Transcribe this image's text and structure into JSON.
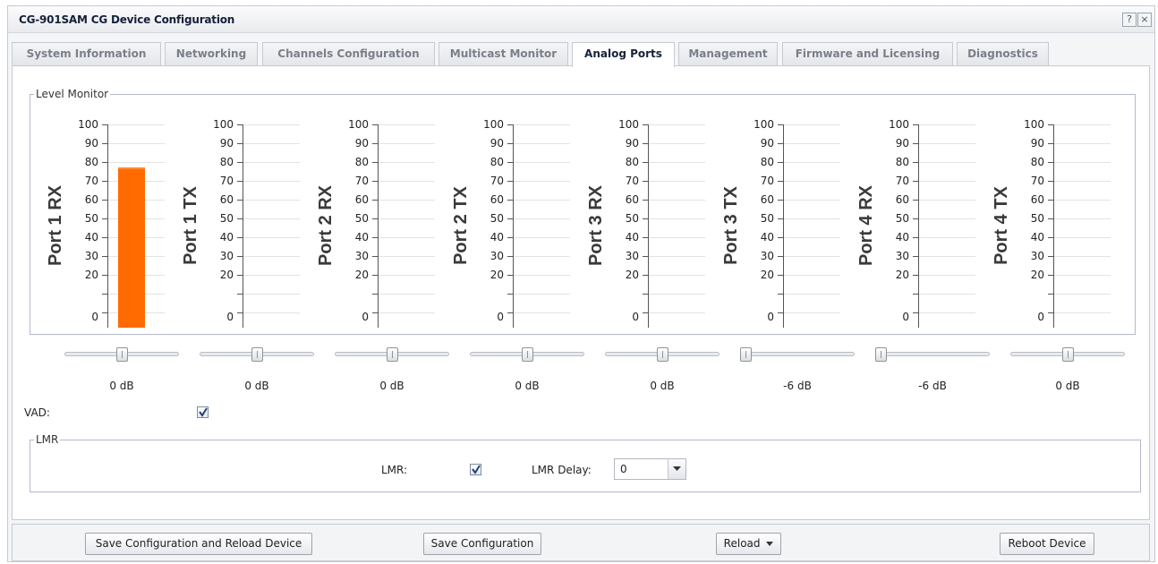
{
  "window": {
    "title": "CG-901SAM CG Device Configuration",
    "help_label": "?",
    "close_label": "×"
  },
  "tabs": [
    {
      "label": "System Information",
      "active": false
    },
    {
      "label": "Networking",
      "active": false
    },
    {
      "label": "Channels Configuration",
      "active": false
    },
    {
      "label": "Multicast Monitor",
      "active": false
    },
    {
      "label": "Analog Ports",
      "active": true
    },
    {
      "label": "Management",
      "active": false
    },
    {
      "label": "Firmware and Licensing",
      "active": false
    },
    {
      "label": "Diagnostics",
      "active": false
    }
  ],
  "level_monitor": {
    "legend": "Level Monitor",
    "tick_labels": [
      "100",
      "90",
      "80",
      "70",
      "60",
      "50",
      "40",
      "30",
      "20",
      "0"
    ],
    "meters": [
      {
        "port": "Port 1 RX",
        "level": 79
      },
      {
        "port": "Port 1 TX",
        "level": 0
      },
      {
        "port": "Port 2 RX",
        "level": 0
      },
      {
        "port": "Port 2 TX",
        "level": 0
      },
      {
        "port": "Port 3 RX",
        "level": 0
      },
      {
        "port": "Port 3 TX",
        "level": 0
      },
      {
        "port": "Port 4 RX",
        "level": 0
      },
      {
        "port": "Port 4 TX",
        "level": 0
      }
    ],
    "bar_color": "#ff6b00"
  },
  "gain_sliders": [
    {
      "value": "0 dB",
      "fraction": 0.5
    },
    {
      "value": "0 dB",
      "fraction": 0.5
    },
    {
      "value": "0 dB",
      "fraction": 0.5
    },
    {
      "value": "0 dB",
      "fraction": 0.5
    },
    {
      "value": "0 dB",
      "fraction": 0.5
    },
    {
      "value": "-6 dB",
      "fraction": 0.0
    },
    {
      "value": "-6 dB",
      "fraction": 0.0
    },
    {
      "value": "0 dB",
      "fraction": 0.5
    }
  ],
  "vad": {
    "label": "VAD:",
    "checked": true
  },
  "lmr": {
    "legend": "LMR",
    "lmr_label": "LMR:",
    "lmr_checked": true,
    "delay_label": "LMR Delay:",
    "delay_value": "0"
  },
  "footer": {
    "save_reload_label": "Save Configuration and Reload Device",
    "save_label": "Save Configuration",
    "reload_label": "Reload",
    "reboot_label": "Reboot Device"
  }
}
